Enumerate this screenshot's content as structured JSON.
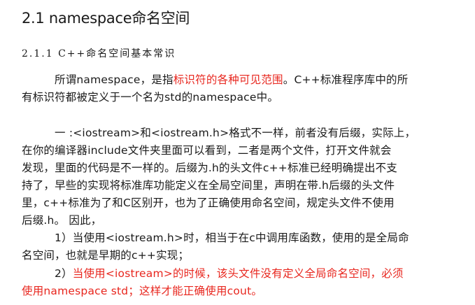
{
  "section_title": "2.1 namespace命名空间",
  "subsection_title": "2.1.1  C++命名空间基本常识",
  "para1": {
    "l1_a": "所谓namespace，是指",
    "l1_red": "标识符的各种可见范围",
    "l1_b": "。C++标准程序库中的所",
    "l2": "有标识符都被定义于一个名为std的namespace中。"
  },
  "para2": {
    "l1": "一 :<iostream>和<iostream.h>格式不一样，前者没有后缀，实际上，",
    "l2": "在你的编译器include文件夹里面可以看到，二者是两个文件，打开文件就会",
    "l3": "发现，里面的代码是不一样的。后缀为.h的头文件c++标准已经明确提出不支",
    "l4": "持了，早些的实现将标准库功能定义在全局空间里，声明在带.h后缀的头文件",
    "l5": "里，c++标准为了和C区别开，也为了正确使用命名空间，规定头文件不使用",
    "l6": "后缀.h。 因此，"
  },
  "item1": {
    "l1": "1）当使用<iostream.h>时，相当于在c中调用库函数，使用的是全局命",
    "l2": "名空间，也就是早期的c++实现；"
  },
  "item2": {
    "l1_a": "2）",
    "l1_red": "当使用<iostream>的时候，该头文件没有定义全局命名空间，必须",
    "l2_red": "使用namespace std；这样才能正确使用cout。"
  },
  "colors": {
    "text": "#1a1a1a",
    "highlight": "#e8261e"
  }
}
